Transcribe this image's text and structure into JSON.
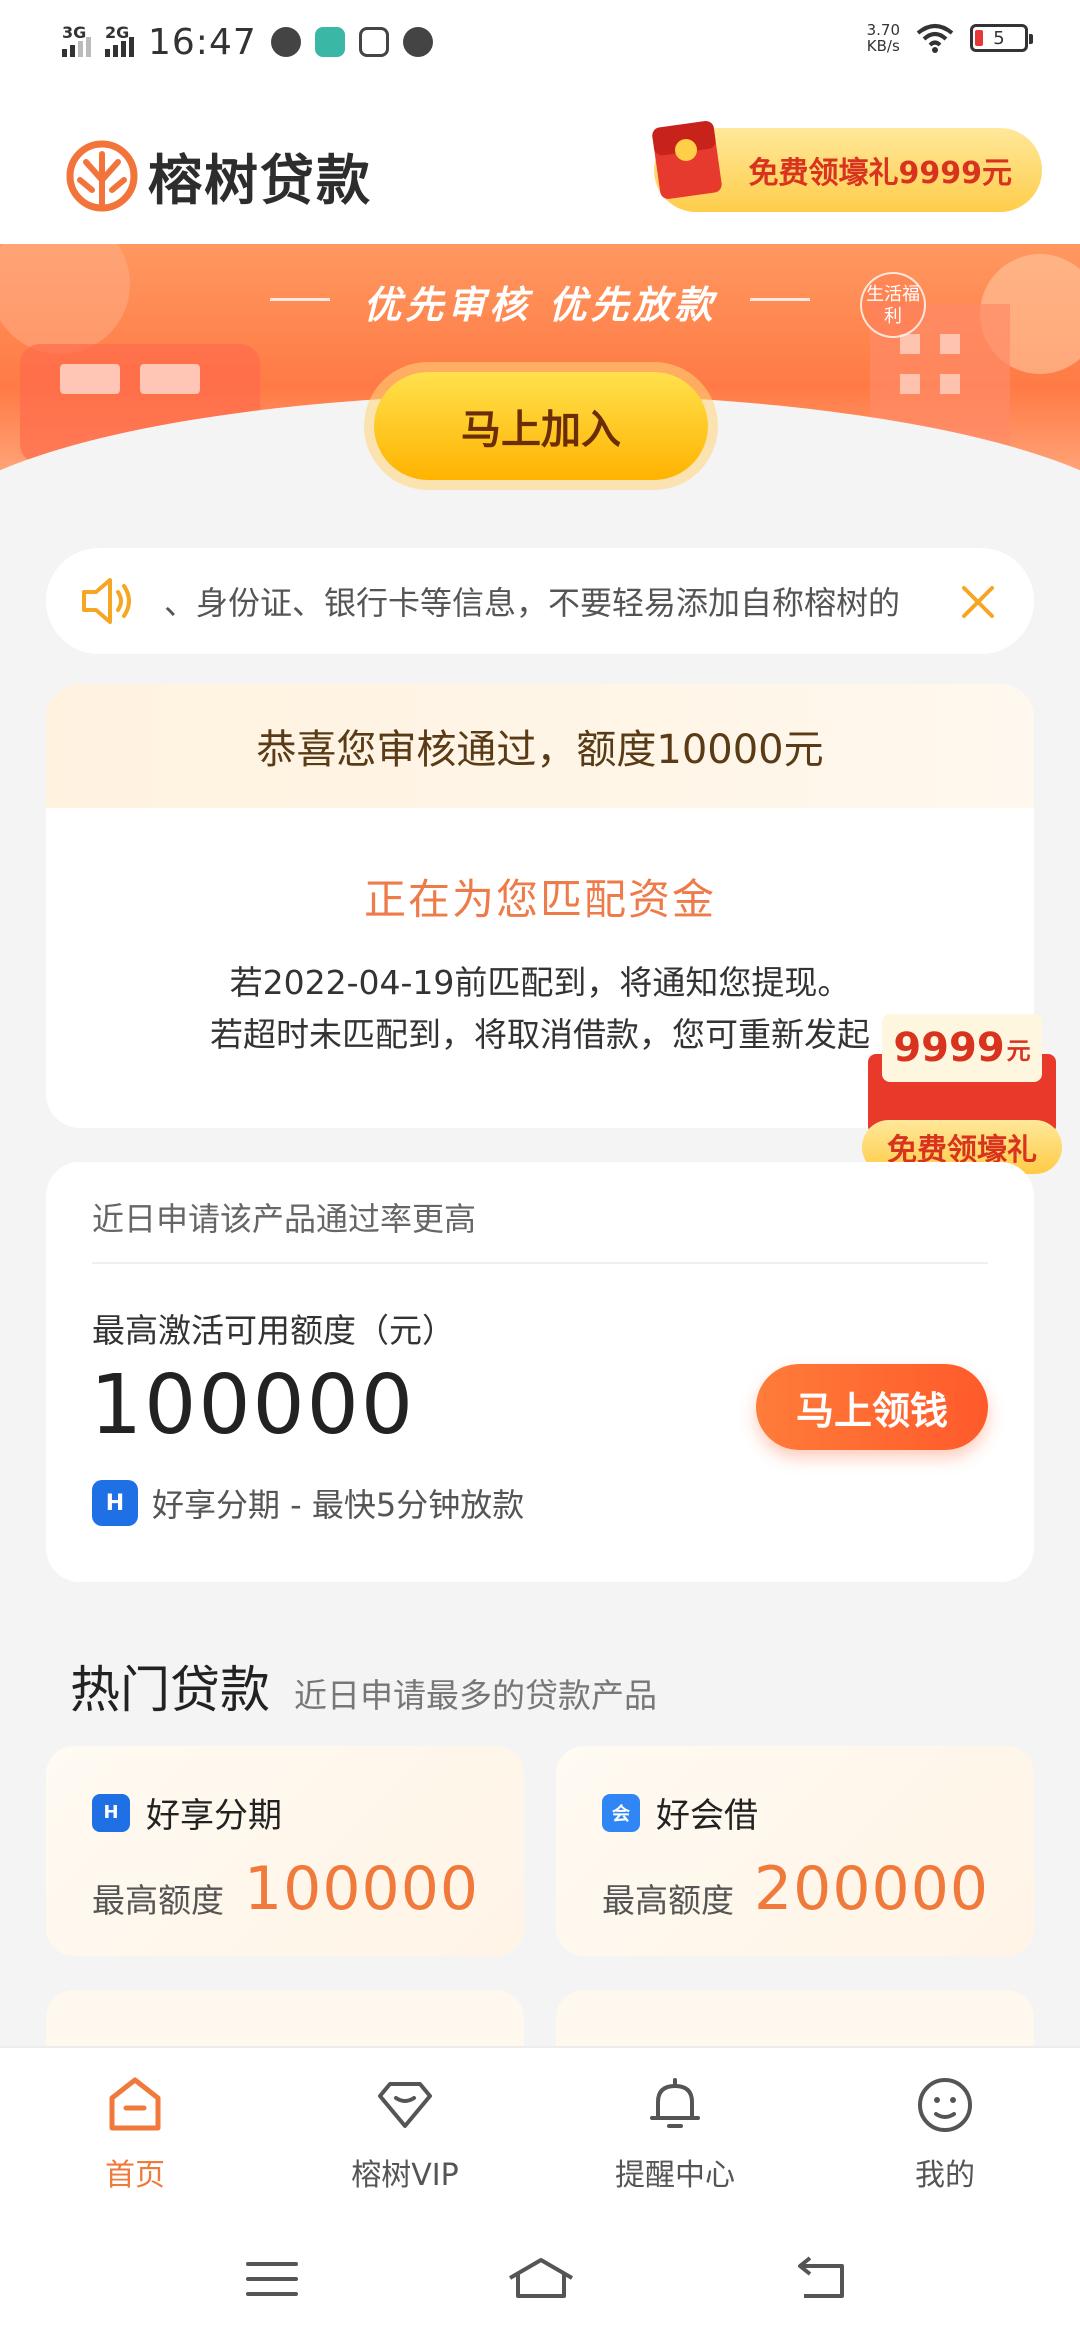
{
  "status_bar": {
    "net1": "3G",
    "net2": "2G",
    "time": "16:47",
    "speed_value": "3.70",
    "speed_unit": "KB/s",
    "battery": "5"
  },
  "header": {
    "brand": "榕树贷款",
    "gift_pill": "免费领壕礼9999元"
  },
  "banner": {
    "slogan": "优先审核 优先放款",
    "badge": "生活福利",
    "join_button": "马上加入"
  },
  "notice": {
    "text": "、身份证、银行卡等信息，不要轻易添加自称榕树的"
  },
  "approval": {
    "headline": "恭喜您审核通过，额度10000元",
    "matching": "正在为您匹配资金",
    "line1": "若2022-04-19前匹配到，将通知您提现。",
    "line2": "若超时未匹配到，将取消借款，您可重新发起"
  },
  "float_gift": {
    "amount": "9999",
    "unit": "元",
    "label": "免费领壕礼"
  },
  "loan_card": {
    "tip": "近日申请该产品通过率更高",
    "label": "最高激活可用额度（元）",
    "amount": "100000",
    "button": "马上领钱",
    "source": "好享分期 - 最快5分钟放款"
  },
  "hot_loans": {
    "title": "热门贷款",
    "subtitle": "近日申请最多的贷款产品",
    "items": [
      {
        "name": "好享分期",
        "label": "最高额度",
        "amount": "100000"
      },
      {
        "name": "好会借",
        "label": "最高额度",
        "amount": "200000"
      }
    ]
  },
  "tabbar": {
    "tabs": [
      {
        "label": "首页"
      },
      {
        "label": "榕树VIP"
      },
      {
        "label": "提醒中心"
      },
      {
        "label": "我的"
      }
    ]
  },
  "colors": {
    "accent": "#f07a3b",
    "button_orange": "#ff5a2a",
    "gold": "#ffcd4b"
  }
}
